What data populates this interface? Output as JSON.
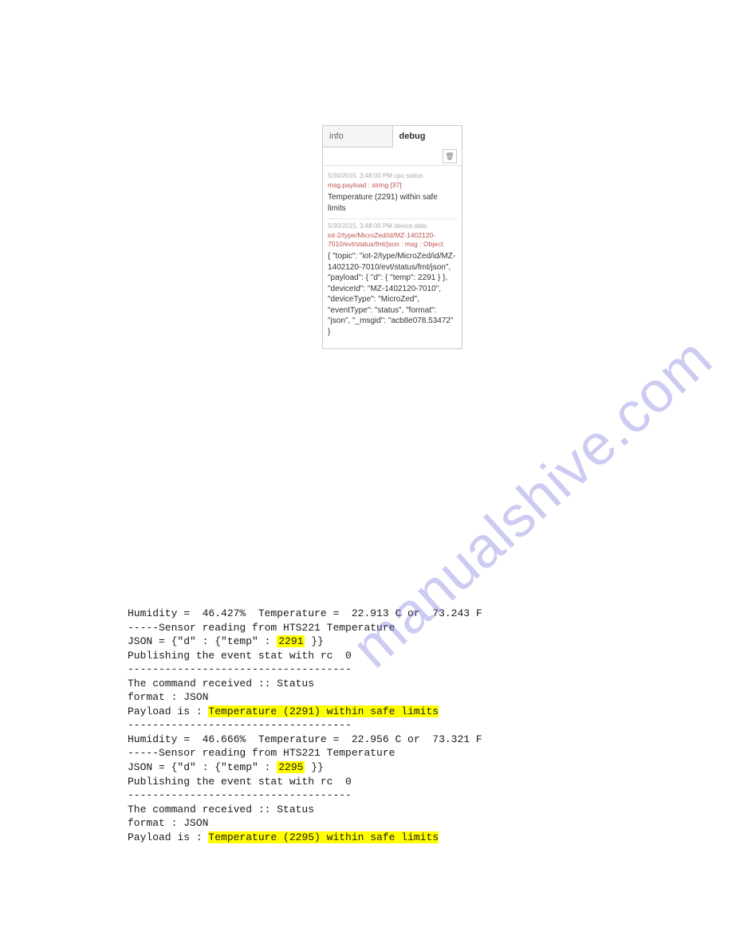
{
  "watermark": "manualshive.com",
  "panel": {
    "tabs": {
      "info": "info",
      "debug": "debug"
    },
    "trash_icon": "🗑",
    "msg1": {
      "meta": "5/30/2015, 3:48:00 PM   cpu status",
      "topic": "msg.payload : string [37]",
      "body": "Temperature (2291) within safe limits"
    },
    "msg2": {
      "meta": "5/30/2015, 3:48:00 PM   device data",
      "topic": "iot-2/type/MicroZed/id/MZ-1402120-7010/evt/status/fmt/json : msg : Object",
      "body": "{ \"topic\": \"iot-2/type/MicroZed/id/MZ-1402120-7010/evt/status/fmt/json\", \"payload\": { \"d\": { \"temp\": 2291 } }, \"deviceId\": \"MZ-1402120-7010\", \"deviceType\": \"MicroZed\", \"eventType\": \"status\", \"format\": \"json\", \"_msgid\": \"acb8e078.53472\" }"
    }
  },
  "log": {
    "l01": "Humidity =  46.427%  Temperature =  22.913 C or  73.243 F",
    "l02": "-----Sensor reading from HTS221 Temperature",
    "l03a": "JSON = {\"d\" : {\"temp\" : ",
    "l03h": "2291",
    "l03b": " }}",
    "l04": "Publishing the event stat with rc  0",
    "l05": "------------------------------------",
    "l06": "The command received :: Status",
    "l07": "format : JSON",
    "l08a": "Payload is : ",
    "l08h": "Temperature (2291) within safe limits",
    "l09": "------------------------------------",
    "l10": "Humidity =  46.666%  Temperature =  22.956 C or  73.321 F",
    "l11": "-----Sensor reading from HTS221 Temperature",
    "l12a": "JSON = {\"d\" : {\"temp\" : ",
    "l12h": "2295",
    "l12b": " }}",
    "l13": "Publishing the event stat with rc  0",
    "l14": "------------------------------------",
    "l15": "The command received :: Status",
    "l16": "format : JSON",
    "l17a": "Payload is : ",
    "l17h": "Temperature (2295) within safe limits"
  }
}
